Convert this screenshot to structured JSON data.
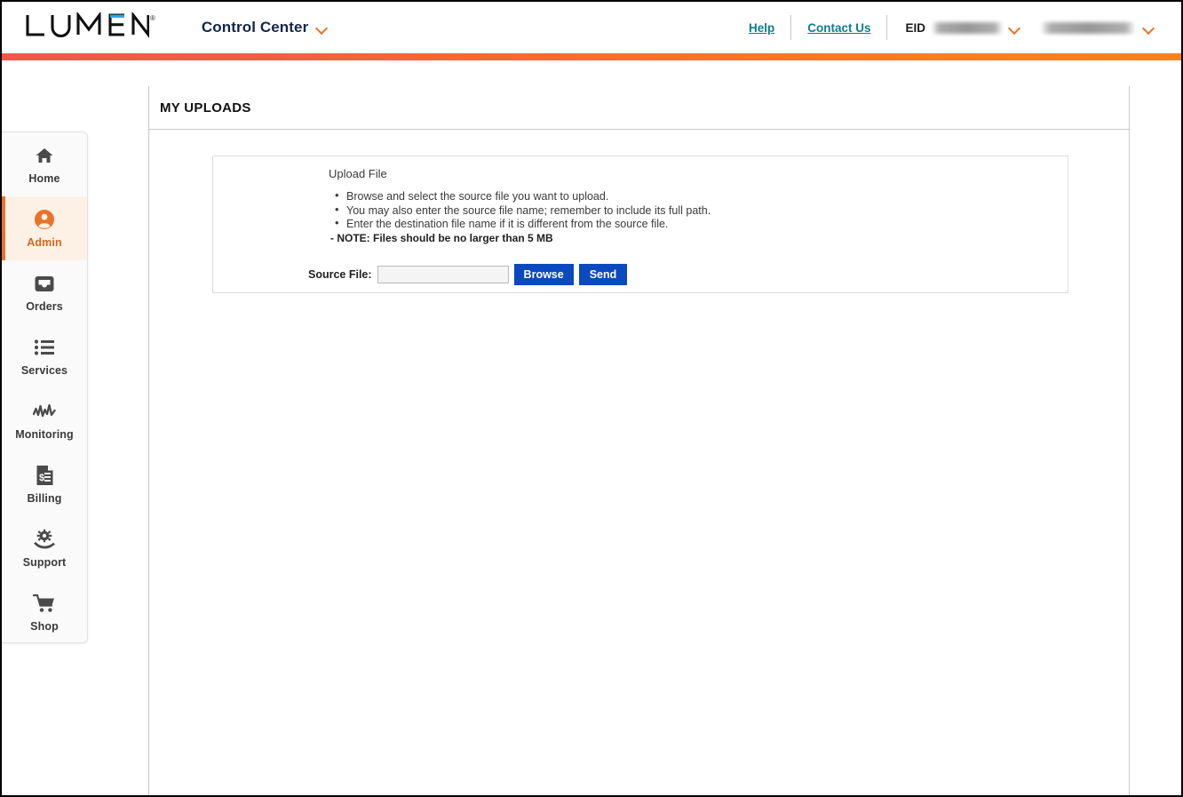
{
  "header": {
    "logo_text": "LUMEN",
    "logo_registered": "®",
    "brand_menu_label": "Control Center",
    "brand_chevron_icon": "chevron-down-icon",
    "help_label": "Help",
    "contact_label": "Contact Us",
    "eid_label": "EID",
    "eid_value": "",
    "eid_chevron_icon": "chevron-down-icon",
    "account_value": "",
    "account_chevron_icon": "chevron-down-icon",
    "link_color": "#0b7d8f",
    "accent_color": "#e8732a",
    "gradient_start": "#f4564a",
    "gradient_end": "#f58220"
  },
  "sidebar": {
    "items": [
      {
        "label": "Home",
        "icon": "home-icon",
        "active": false
      },
      {
        "label": "Admin",
        "icon": "user-circle-icon",
        "active": true
      },
      {
        "label": "Orders",
        "icon": "inbox-tray-icon",
        "active": false
      },
      {
        "label": "Services",
        "icon": "list-bullets-icon",
        "active": false
      },
      {
        "label": "Monitoring",
        "icon": "waveform-icon",
        "active": false
      },
      {
        "label": "Billing",
        "icon": "invoice-icon",
        "active": false
      },
      {
        "label": "Support",
        "icon": "gear-in-hand-icon",
        "active": false
      },
      {
        "label": "Shop",
        "icon": "shopping-cart-icon",
        "active": false
      }
    ],
    "active_bg": "#fdf1e6",
    "active_accent": "#e8732a"
  },
  "main": {
    "page_title": "MY UPLOADS",
    "upload_panel": {
      "heading": "Upload File",
      "bullets": [
        "Browse and select the source file you want to upload.",
        "You may also enter the source file name; remember to include its full path.",
        "Enter the destination file name if it is different from the source file."
      ],
      "note": "- NOTE: Files should be no larger than 5 MB",
      "source_file_label": "Source File:",
      "source_file_value": "",
      "source_file_placeholder": "",
      "browse_label": "Browse",
      "send_label": "Send",
      "button_color": "#0b49c0"
    }
  }
}
